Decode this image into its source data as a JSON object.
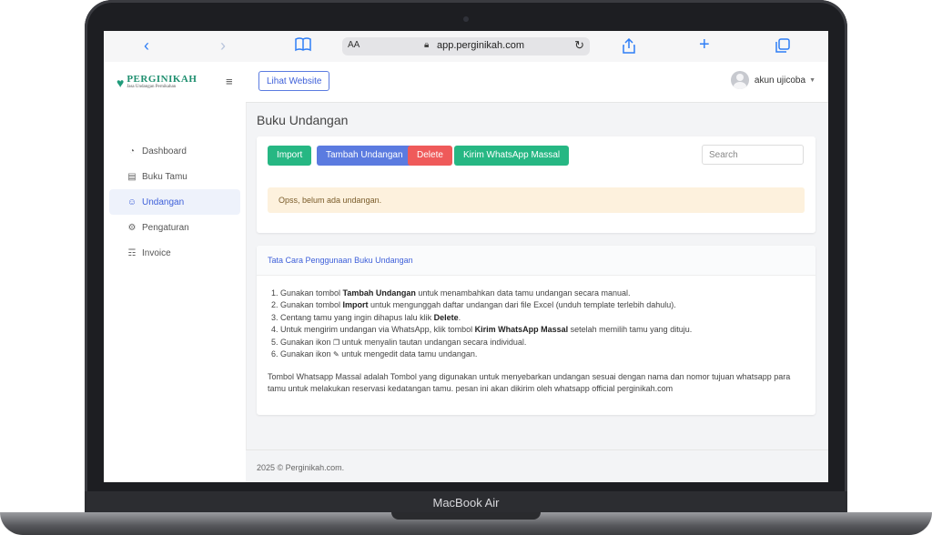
{
  "device_label": "MacBook Air",
  "browser": {
    "aa": "AA",
    "url": "app.perginikah.com"
  },
  "brand": {
    "name": "PERGINIKAH",
    "tagline": "Jasa Undangan Pernikahan"
  },
  "sidebar": {
    "items": [
      {
        "label": "Dashboard",
        "icon": "dashboard-icon",
        "active": false
      },
      {
        "label": "Buku Tamu",
        "icon": "book-icon",
        "active": false
      },
      {
        "label": "Undangan",
        "icon": "invitation-icon",
        "active": true
      },
      {
        "label": "Pengaturan",
        "icon": "gear-icon",
        "active": false
      },
      {
        "label": "Invoice",
        "icon": "cart-icon",
        "active": false
      }
    ]
  },
  "header": {
    "lihat_website": "Lihat Website",
    "username": "akun ujicoba"
  },
  "page": {
    "title": "Buku Undangan"
  },
  "toolbar": {
    "import": "Import",
    "tambah": "Tambah Undangan",
    "delete": "Delete",
    "kirim": "Kirim WhatsApp Massal",
    "search_placeholder": "Search"
  },
  "alert": {
    "text": "Opss, belum ada undangan."
  },
  "guide": {
    "title": "Tata Cara Penggunaan Buku Undangan",
    "steps": [
      {
        "pre": "Gunakan tombol ",
        "bold": "Tambah Undangan",
        "post": " untuk menambahkan data tamu undangan secara manual."
      },
      {
        "pre": "Gunakan tombol ",
        "bold": "Import",
        "post": " untuk mengunggah daftar undangan dari file Excel (unduh template terlebih dahulu)."
      },
      {
        "pre": "Centang tamu yang ingin dihapus lalu klik ",
        "bold": "Delete",
        "post": "."
      },
      {
        "pre": "Untuk mengirim undangan via WhatsApp, klik tombol ",
        "bold": "Kirim WhatsApp Massal",
        "post": " setelah memilih tamu yang dituju."
      },
      {
        "pre": "Gunakan ikon ",
        "icon": "copy-icon",
        "post": " untuk menyalin tautan undangan secara individual."
      },
      {
        "pre": "Gunakan ikon ",
        "icon": "pencil-icon",
        "post": " untuk mengedit data tamu undangan."
      }
    ],
    "note": "Tombol Whatsapp Massal adalah Tombol yang digunakan untuk menyebarkan undangan sesuai dengan nama dan nomor tujuan whatsapp para tamu untuk melakukan reservasi kedatangan tamu. pesan ini akan dikirim oleh whatsapp official perginikah.com"
  },
  "footer": {
    "text": "2025 © Perginikah.com."
  },
  "colors": {
    "primary": "#5b7be0",
    "success": "#26b783",
    "danger": "#ef5a5a",
    "warning_bg": "#fdf1dd"
  }
}
